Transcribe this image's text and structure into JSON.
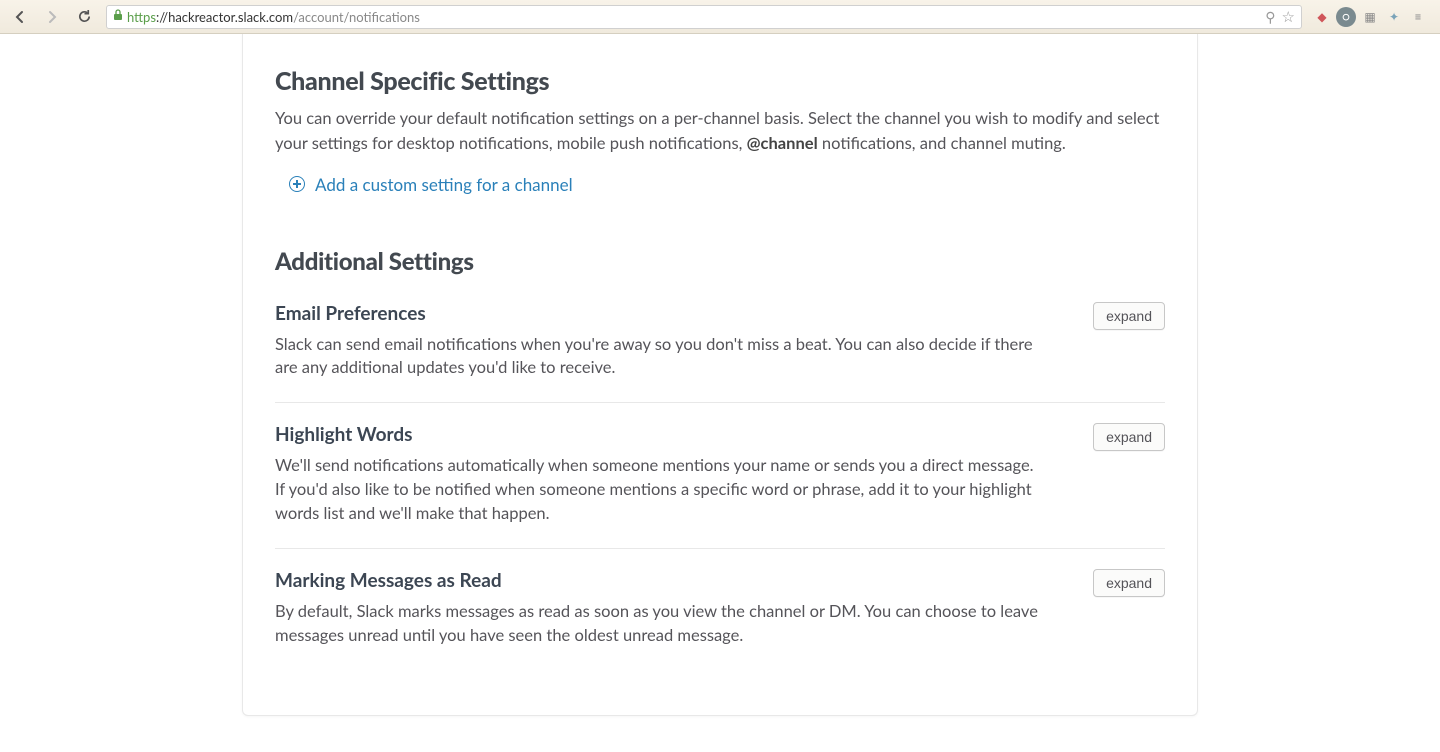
{
  "browser": {
    "url_scheme": "https",
    "url_host": "://hackreactor.slack.com",
    "url_path": "/account/notifications"
  },
  "channel_section": {
    "heading": "Channel Specific Settings",
    "description_part1": "You can override your default notification settings on a per-channel basis. Select the channel you wish to modify and select your settings for desktop notifications, mobile push notifications, ",
    "description_bold": "@channel",
    "description_part2": " notifications, and channel muting.",
    "add_link": "Add a custom setting for a channel"
  },
  "additional_section": {
    "heading": "Additional Settings",
    "items": [
      {
        "title": "Email Preferences",
        "description": "Slack can send email notifications when you're away so you don't miss a beat. You can also decide if there are any additional updates you'd like to receive.",
        "button": "expand"
      },
      {
        "title": "Highlight Words",
        "description": "We'll send notifications automatically when someone mentions your name or sends you a direct message. If you'd also like to be notified when someone mentions a specific word or phrase, add it to your highlight words list and we'll make that happen.",
        "button": "expand"
      },
      {
        "title": "Marking Messages as Read",
        "description": "By default, Slack marks messages as read as soon as you view the channel or DM. You can choose to leave messages unread until you have seen the oldest unread message.",
        "button": "expand"
      }
    ]
  }
}
